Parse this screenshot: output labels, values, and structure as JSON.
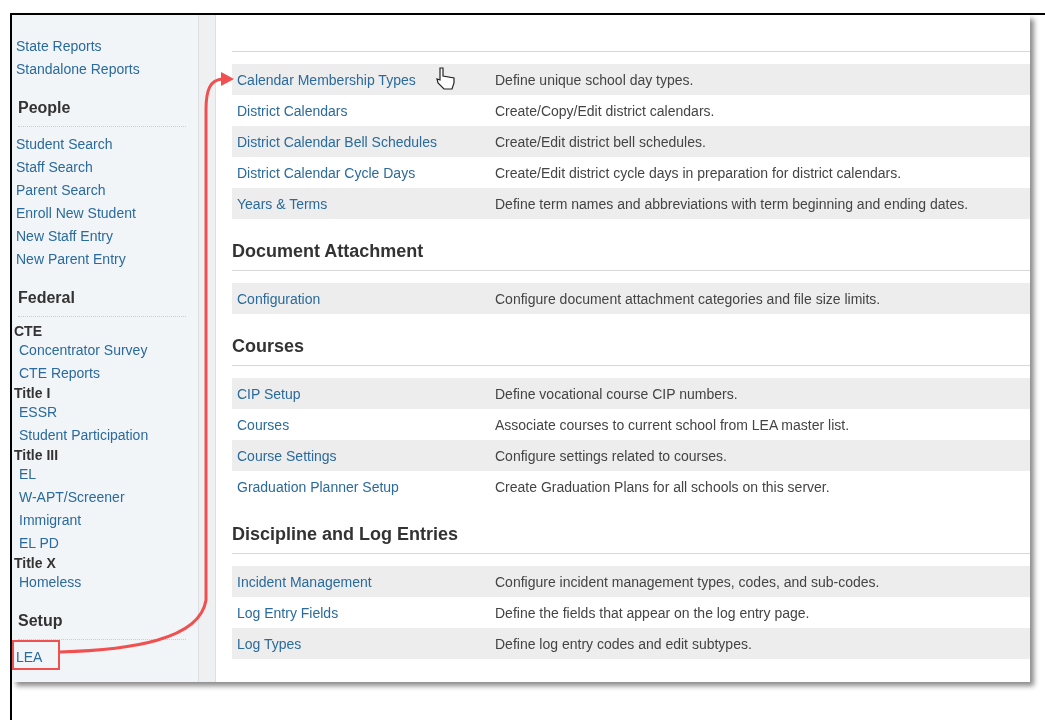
{
  "sidebar": {
    "sections": [
      {
        "groups": [
          {
            "items": [
              "State Reports",
              "Standalone Reports"
            ]
          }
        ]
      },
      {
        "heading": "People",
        "groups": [
          {
            "items": [
              "Student Search",
              "Staff Search",
              "Parent Search",
              "Enroll New Student",
              "New Staff Entry",
              "New Parent Entry"
            ]
          }
        ]
      },
      {
        "heading": "Federal",
        "groups": [
          {
            "label": "CTE",
            "items": [
              "Concentrator Survey",
              "CTE Reports"
            ]
          },
          {
            "label": "Title I",
            "items": [
              "ESSR",
              "Student Participation"
            ]
          },
          {
            "label": "Title III",
            "items": [
              "EL",
              "W-APT/Screener",
              "Immigrant",
              "EL PD"
            ]
          },
          {
            "label": "Title X",
            "items": [
              "Homeless"
            ]
          }
        ]
      },
      {
        "heading": "Setup",
        "groups": [
          {
            "items": [
              "LEA"
            ]
          }
        ]
      }
    ]
  },
  "sections": [
    {
      "rows": [
        {
          "name": "Calendar Membership Types",
          "description": "Define unique school day types."
        },
        {
          "name": "District Calendars",
          "description": "Create/Copy/Edit district calendars."
        },
        {
          "name": "District Calendar Bell Schedules",
          "description": "Create/Edit district bell schedules."
        },
        {
          "name": "District Calendar Cycle Days",
          "description": "Create/Edit district cycle days in preparation for district calendars."
        },
        {
          "name": "Years & Terms",
          "description": "Define term names and abbreviations with term beginning and ending dates."
        }
      ]
    },
    {
      "heading": "Document Attachment",
      "rows": [
        {
          "name": "Configuration",
          "description": "Configure document attachment categories and file size limits."
        }
      ]
    },
    {
      "heading": "Courses",
      "rows": [
        {
          "name": "CIP Setup",
          "description": "Define vocational course CIP numbers."
        },
        {
          "name": "Courses",
          "description": "Associate courses to current school from LEA master list."
        },
        {
          "name": "Course Settings",
          "description": "Configure settings related to courses."
        },
        {
          "name": "Graduation Planner Setup",
          "description": "Create Graduation Plans for all schools on this server."
        }
      ]
    },
    {
      "heading": "Discipline and Log Entries",
      "rows": [
        {
          "name": "Incident Management",
          "description": "Configure incident management types, codes, and sub-codes."
        },
        {
          "name": "Log Entry Fields",
          "description": "Define the fields that appear on the log entry page."
        },
        {
          "name": "Log Types",
          "description": "Define log entry codes and edit subtypes."
        }
      ]
    }
  ]
}
